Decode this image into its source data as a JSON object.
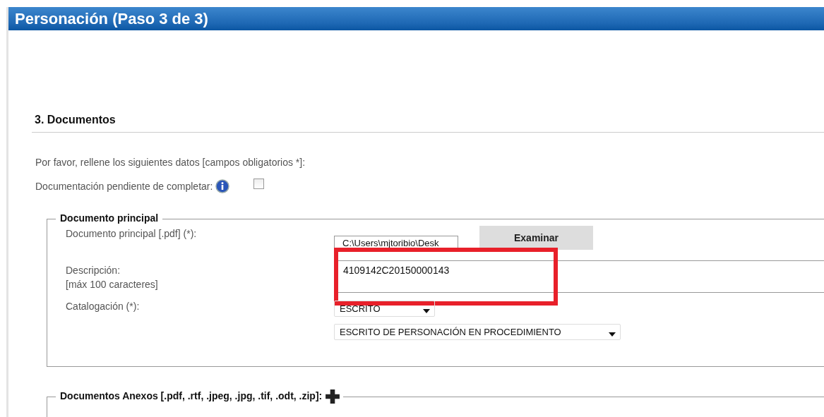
{
  "header": {
    "title": "Personación (Paso 3 de 3)"
  },
  "section": {
    "title": "3. Documentos",
    "instructions": "Por favor, rellene los siguientes datos [campos obligatorios *]:",
    "pending": {
      "label": "Documentación pendiente de completar:",
      "checked": false
    }
  },
  "main_document": {
    "legend": "Documento principal",
    "file": {
      "label": "Documento principal [.pdf] (*):",
      "value": "C:\\Users\\mjtoribio\\Desk",
      "button": "Examinar"
    },
    "description": {
      "label": "Descripción:",
      "hint": "[máx 100 caracteres]",
      "value": "4109142C20150000143",
      "highlighted": true
    },
    "catalog": {
      "label": "Catalogación (*):",
      "type": "ESCRITO",
      "subtype": "ESCRITO DE PERSONACIÓN EN PROCEDIMIENTO"
    }
  },
  "attachments": {
    "legend": "Documentos Anexos [.pdf, .rtf, .jpeg, .jpg, .tif, .odt, .zip]:"
  }
}
